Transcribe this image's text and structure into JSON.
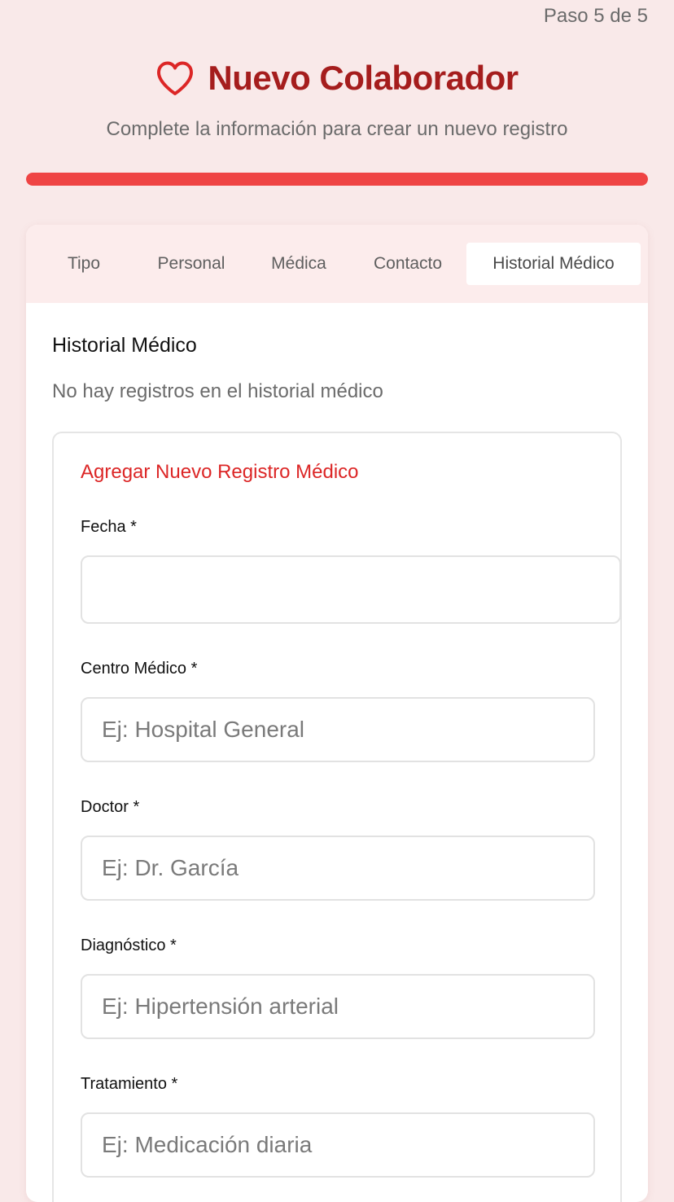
{
  "step": {
    "label": "Paso 5 de 5",
    "progress_percent": 100
  },
  "header": {
    "icon": "heart-icon",
    "title": "Nuevo Colaborador",
    "subtitle": "Complete la información para crear un nuevo registro"
  },
  "colors": {
    "accent": "#ef4444",
    "title": "#a51d1d",
    "section_accent": "#dc2626",
    "background": "#f9e9e9"
  },
  "tabs": [
    {
      "label": "Tipo",
      "active": false
    },
    {
      "label": "Personal",
      "active": false
    },
    {
      "label": "Médica",
      "active": false
    },
    {
      "label": "Contacto",
      "active": false
    },
    {
      "label": "Historial Médico",
      "active": true
    }
  ],
  "history": {
    "title": "Historial Médico",
    "empty_message": "No hay registros en el historial médico"
  },
  "new_record": {
    "title": "Agregar Nuevo Registro Médico",
    "fields": {
      "fecha": {
        "label": "Fecha *",
        "value": "",
        "placeholder": ""
      },
      "centro": {
        "label": "Centro Médico *",
        "value": "",
        "placeholder": "Ej: Hospital General"
      },
      "doctor": {
        "label": "Doctor *",
        "value": "",
        "placeholder": "Ej: Dr. García"
      },
      "diagnostico": {
        "label": "Diagnóstico *",
        "value": "",
        "placeholder": "Ej: Hipertensión arterial"
      },
      "tratamiento": {
        "label": "Tratamiento *",
        "value": "",
        "placeholder": "Ej: Medicación diaria"
      }
    }
  }
}
